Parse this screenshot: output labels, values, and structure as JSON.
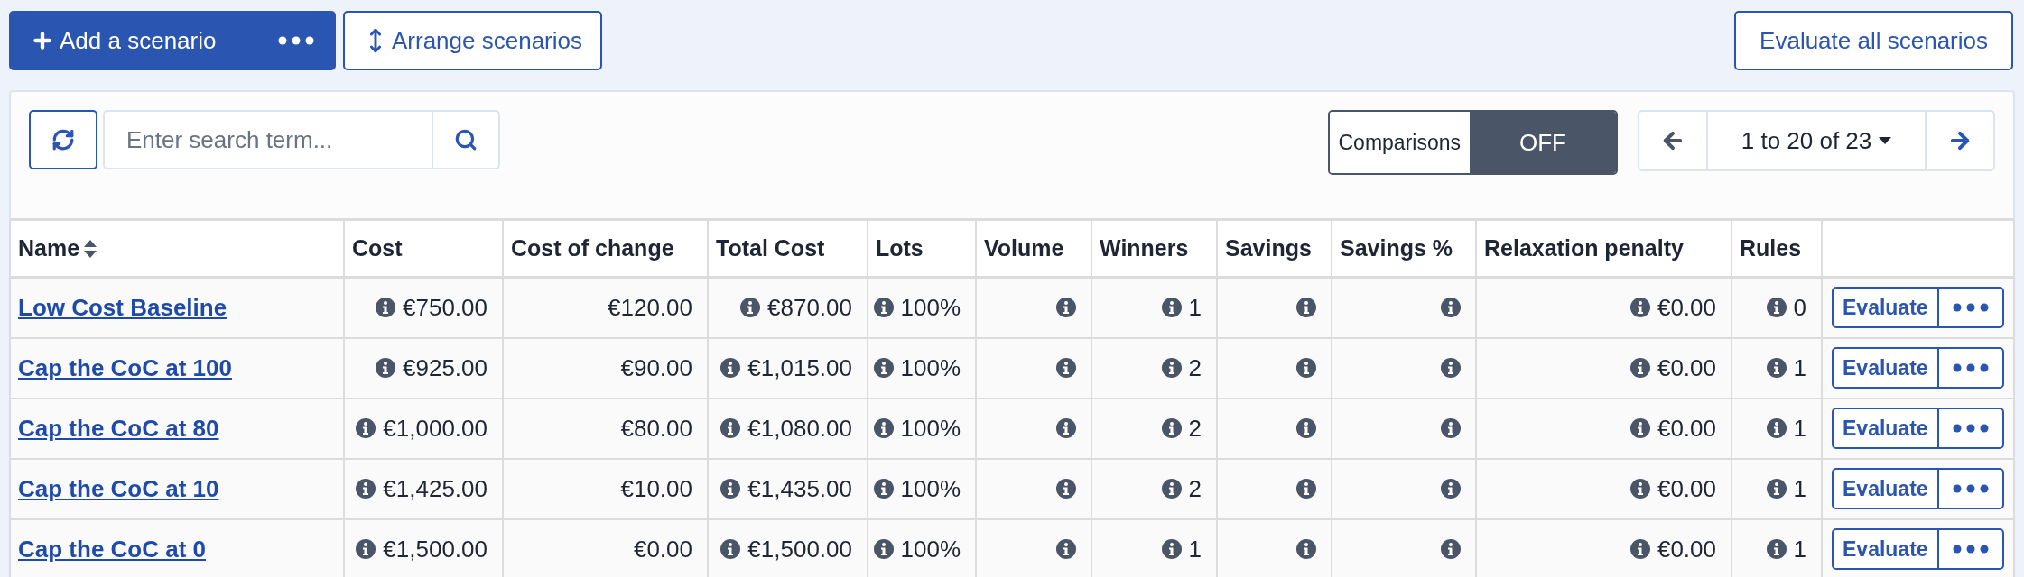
{
  "toolbar": {
    "add_button": "Add a scenario",
    "arrange_button": "Arrange scenarios",
    "evaluate_all_button": "Evaluate all scenarios"
  },
  "search": {
    "placeholder": "Enter search term..."
  },
  "comparisons": {
    "label": "Comparisons",
    "value": "OFF",
    "on": false
  },
  "pagination": {
    "range": "1 to 20 of 23"
  },
  "table": {
    "columns": [
      {
        "label": "Name",
        "sortable": true
      },
      {
        "label": "Cost",
        "sortable": false
      },
      {
        "label": "Cost of change",
        "sortable": false
      },
      {
        "label": "Total Cost",
        "sortable": false
      },
      {
        "label": "Lots",
        "sortable": false
      },
      {
        "label": "Volume",
        "sortable": false
      },
      {
        "label": "Winners",
        "sortable": false
      },
      {
        "label": "Savings",
        "sortable": false
      },
      {
        "label": "Savings %",
        "sortable": false
      },
      {
        "label": "Relaxation penalty",
        "sortable": false
      },
      {
        "label": "Rules",
        "sortable": false
      }
    ],
    "rows": [
      {
        "cells": [
          {
            "kind": "link",
            "text": "Low Cost Baseline"
          },
          {
            "info": true,
            "text": "€750.00"
          },
          {
            "info": false,
            "text": "€120.00"
          },
          {
            "info": true,
            "text": "€870.00"
          },
          {
            "info": true,
            "text": "100%"
          },
          {
            "info": true
          },
          {
            "info": true,
            "text": "1"
          },
          {
            "info": true
          },
          {
            "info": true
          },
          {
            "info": true,
            "text": "€0.00"
          },
          {
            "info": true,
            "text": "0"
          }
        ],
        "evaluate": "Evaluate"
      },
      {
        "cells": [
          {
            "kind": "link",
            "text": "Cap the CoC at 100"
          },
          {
            "info": true,
            "text": "€925.00"
          },
          {
            "info": false,
            "text": "€90.00"
          },
          {
            "info": true,
            "text": "€1,015.00"
          },
          {
            "info": true,
            "text": "100%"
          },
          {
            "info": true
          },
          {
            "info": true,
            "text": "2"
          },
          {
            "info": true
          },
          {
            "info": true
          },
          {
            "info": true,
            "text": "€0.00"
          },
          {
            "info": true,
            "text": "1"
          }
        ],
        "evaluate": "Evaluate"
      },
      {
        "cells": [
          {
            "kind": "link",
            "text": "Cap the CoC at 80"
          },
          {
            "info": true,
            "text": "€1,000.00"
          },
          {
            "info": false,
            "text": "€80.00"
          },
          {
            "info": true,
            "text": "€1,080.00"
          },
          {
            "info": true,
            "text": "100%"
          },
          {
            "info": true
          },
          {
            "info": true,
            "text": "2"
          },
          {
            "info": true
          },
          {
            "info": true
          },
          {
            "info": true,
            "text": "€0.00"
          },
          {
            "info": true,
            "text": "1"
          }
        ],
        "evaluate": "Evaluate"
      },
      {
        "cells": [
          {
            "kind": "link",
            "text": "Cap the CoC at 10"
          },
          {
            "info": true,
            "text": "€1,425.00"
          },
          {
            "info": false,
            "text": "€10.00"
          },
          {
            "info": true,
            "text": "€1,435.00"
          },
          {
            "info": true,
            "text": "100%"
          },
          {
            "info": true
          },
          {
            "info": true,
            "text": "2"
          },
          {
            "info": true
          },
          {
            "info": true
          },
          {
            "info": true,
            "text": "€0.00"
          },
          {
            "info": true,
            "text": "1"
          }
        ],
        "evaluate": "Evaluate"
      },
      {
        "cells": [
          {
            "kind": "link",
            "text": "Cap the CoC at 0"
          },
          {
            "info": true,
            "text": "€1,500.00"
          },
          {
            "info": false,
            "text": "€0.00"
          },
          {
            "info": true,
            "text": "€1,500.00"
          },
          {
            "info": true,
            "text": "100%"
          },
          {
            "info": true
          },
          {
            "info": true,
            "text": "1"
          },
          {
            "info": true
          },
          {
            "info": true
          },
          {
            "info": true,
            "text": "€0.00"
          },
          {
            "info": true,
            "text": "1"
          }
        ],
        "evaluate": "Evaluate"
      }
    ]
  }
}
